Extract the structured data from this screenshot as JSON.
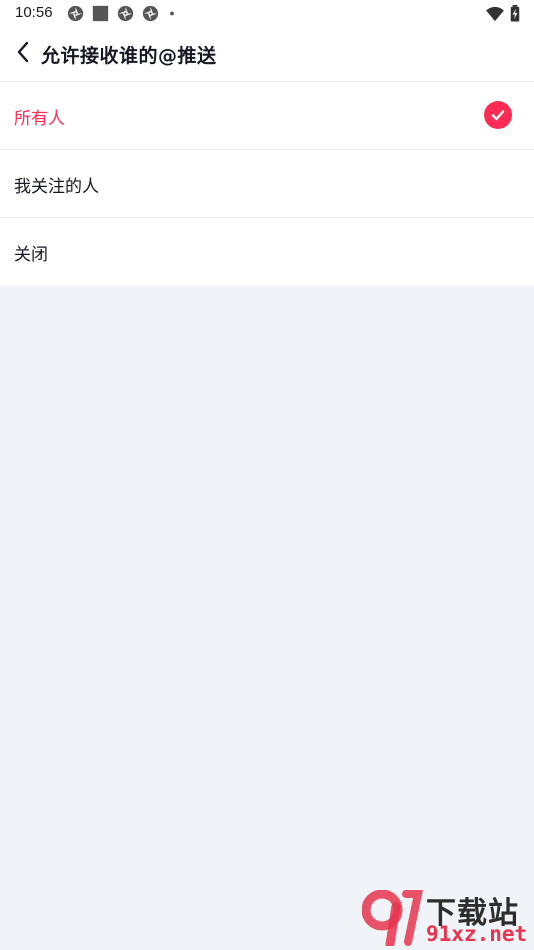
{
  "status_bar": {
    "time": "10:56",
    "icons": [
      "app-notification-icon",
      "square-notification-icon",
      "app-notification-icon",
      "app-notification-icon",
      "more-dot-icon"
    ],
    "right_icons": [
      "wifi-icon",
      "battery-charging-icon"
    ]
  },
  "header": {
    "title": "允许接收谁的@推送",
    "back_icon": "chevron-left-icon"
  },
  "options": [
    {
      "label": "所有人",
      "selected": true
    },
    {
      "label": "我关注的人",
      "selected": false
    },
    {
      "label": "关闭",
      "selected": false
    }
  ],
  "colors": {
    "accent": "#fe2c55",
    "background": "#f0f3f7",
    "text": "#161823"
  },
  "watermark": {
    "cn": "下载站",
    "en": "91xz.net"
  }
}
